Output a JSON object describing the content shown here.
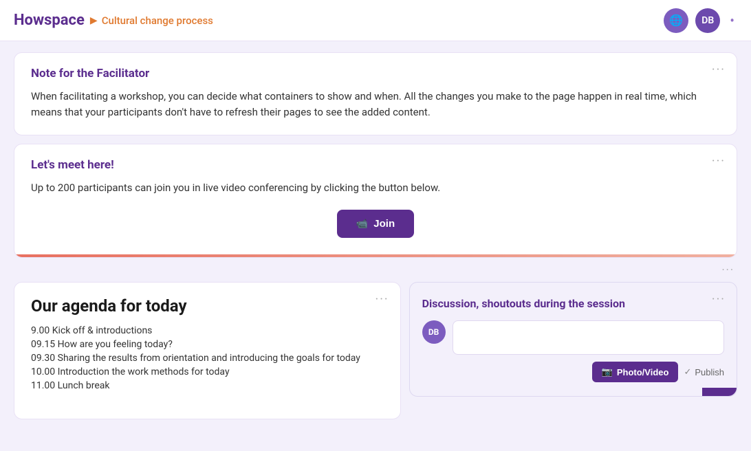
{
  "header": {
    "logo": "Howspace",
    "breadcrumb_arrow": "▶",
    "breadcrumb_title": "Cultural change process",
    "avatar_initials": "DB",
    "globe_symbol": "🌐"
  },
  "note_card": {
    "title": "Note for the Facilitator",
    "text": "When facilitating a workshop, you can decide what containers to show and when. All the changes you make to the page happen in real time, which means that your participants don't have to refresh their pages to see the added content.",
    "dots": "···"
  },
  "meet_card": {
    "title": "Let's meet here!",
    "text": "Up to 200 participants can join you in live video conferencing by clicking the button below.",
    "dots": "···",
    "join_label": "Join"
  },
  "divider_dots": "···",
  "agenda_card": {
    "title": "Our agenda for today",
    "dots": "···",
    "items": [
      "9.00 Kick off & introductions",
      "09.15 How are you feeling today?",
      "09.30 Sharing the results from orientation and introducing the goals for today",
      "10.00 Introduction the work methods for today",
      "11.00 Lunch break"
    ]
  },
  "discussion_card": {
    "title": "Discussion, shoutouts during the session",
    "dots": "···",
    "avatar_initials": "DB",
    "photo_btn_label": "Photo/Video",
    "publish_label": "Publish",
    "camera_symbol": "📷"
  }
}
